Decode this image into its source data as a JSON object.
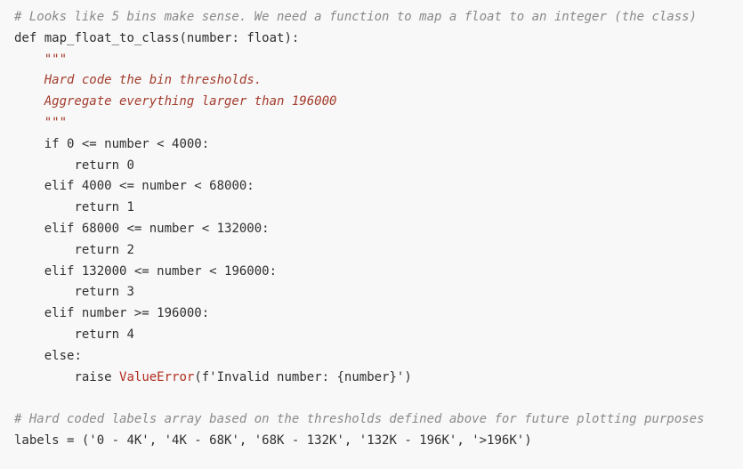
{
  "code": {
    "lines": [
      {
        "indent": "",
        "tokens": [
          {
            "text": "# Looks like 5 bins make sense. We need a function to map a float to an integer (the class)",
            "kind": "comment"
          }
        ]
      },
      {
        "indent": "",
        "tokens": [
          {
            "text": "def",
            "kind": "keyword"
          },
          {
            "text": " map_float_to_class(number: ",
            "kind": "ident"
          },
          {
            "text": "float",
            "kind": "keyword"
          },
          {
            "text": "):",
            "kind": "ident"
          }
        ]
      },
      {
        "indent": "    ",
        "tokens": [
          {
            "text": "\"\"\"",
            "kind": "doc"
          }
        ]
      },
      {
        "indent": "    ",
        "tokens": [
          {
            "text": "Hard code the bin thresholds.",
            "kind": "doc"
          }
        ]
      },
      {
        "indent": "    ",
        "tokens": [
          {
            "text": "Aggregate everything larger than 196000",
            "kind": "doc"
          }
        ]
      },
      {
        "indent": "    ",
        "tokens": [
          {
            "text": "\"\"\"",
            "kind": "doc"
          }
        ]
      },
      {
        "indent": "    ",
        "tokens": [
          {
            "text": "if",
            "kind": "keyword"
          },
          {
            "text": " 0 <= number < 4000:",
            "kind": "ident"
          }
        ]
      },
      {
        "indent": "        ",
        "tokens": [
          {
            "text": "return",
            "kind": "keyword"
          },
          {
            "text": " 0",
            "kind": "ident"
          }
        ]
      },
      {
        "indent": "    ",
        "tokens": [
          {
            "text": "elif",
            "kind": "keyword"
          },
          {
            "text": " 4000 <= number < 68000:",
            "kind": "ident"
          }
        ]
      },
      {
        "indent": "        ",
        "tokens": [
          {
            "text": "return",
            "kind": "keyword"
          },
          {
            "text": " 1",
            "kind": "ident"
          }
        ]
      },
      {
        "indent": "    ",
        "tokens": [
          {
            "text": "elif",
            "kind": "keyword"
          },
          {
            "text": " 68000 <= number < 132000:",
            "kind": "ident"
          }
        ]
      },
      {
        "indent": "        ",
        "tokens": [
          {
            "text": "return",
            "kind": "keyword"
          },
          {
            "text": " 2",
            "kind": "ident"
          }
        ]
      },
      {
        "indent": "    ",
        "tokens": [
          {
            "text": "elif",
            "kind": "keyword"
          },
          {
            "text": " 132000 <= number < 196000:",
            "kind": "ident"
          }
        ]
      },
      {
        "indent": "        ",
        "tokens": [
          {
            "text": "return",
            "kind": "keyword"
          },
          {
            "text": " 3",
            "kind": "ident"
          }
        ]
      },
      {
        "indent": "    ",
        "tokens": [
          {
            "text": "elif",
            "kind": "keyword"
          },
          {
            "text": " number >= 196000:",
            "kind": "ident"
          }
        ]
      },
      {
        "indent": "        ",
        "tokens": [
          {
            "text": "return",
            "kind": "keyword"
          },
          {
            "text": " 4",
            "kind": "ident"
          }
        ]
      },
      {
        "indent": "    ",
        "tokens": [
          {
            "text": "else",
            "kind": "keyword"
          },
          {
            "text": ":",
            "kind": "ident"
          }
        ]
      },
      {
        "indent": "        ",
        "tokens": [
          {
            "text": "raise",
            "kind": "keyword"
          },
          {
            "text": " ",
            "kind": "ident"
          },
          {
            "text": "ValueError",
            "kind": "builtin"
          },
          {
            "text": "(f'Invalid number: {number}')",
            "kind": "string"
          }
        ]
      },
      {
        "indent": "",
        "tokens": []
      },
      {
        "indent": "",
        "tokens": [
          {
            "text": "# Hard coded labels array based on the thresholds defined above for future plotting purposes",
            "kind": "comment"
          }
        ]
      },
      {
        "indent": "",
        "tokens": [
          {
            "text": "labels = (",
            "kind": "ident"
          },
          {
            "text": "'0 - 4K'",
            "kind": "string"
          },
          {
            "text": ", ",
            "kind": "ident"
          },
          {
            "text": "'4K - 68K'",
            "kind": "string"
          },
          {
            "text": ", ",
            "kind": "ident"
          },
          {
            "text": "'68K - 132K'",
            "kind": "string"
          },
          {
            "text": ", ",
            "kind": "ident"
          },
          {
            "text": "'132K - 196K'",
            "kind": "string"
          },
          {
            "text": ", ",
            "kind": "ident"
          },
          {
            "text": "'>196K'",
            "kind": "string"
          },
          {
            "text": ")",
            "kind": "ident"
          }
        ]
      }
    ]
  },
  "colors": {
    "background": "#f8f8f8",
    "comment": "#8a8a8a",
    "docstring": "#a33b2c",
    "builtin": "#b22e1f",
    "text": "#2f2f2f"
  }
}
